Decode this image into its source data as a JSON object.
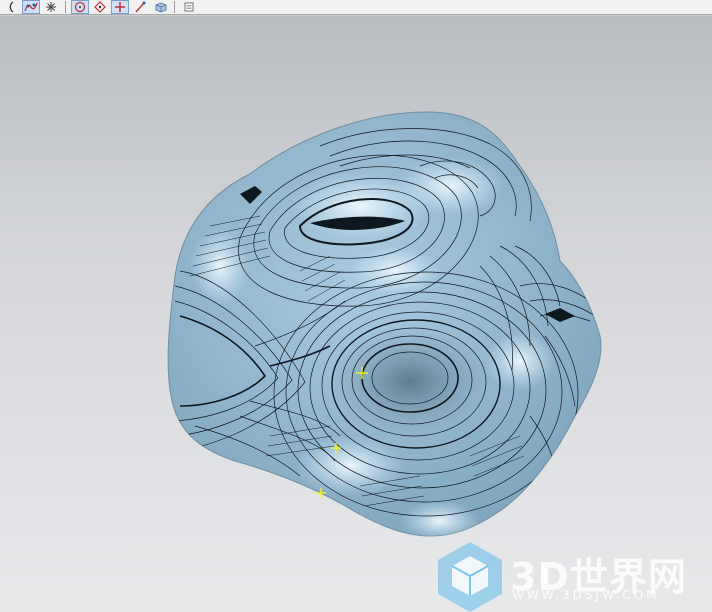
{
  "toolbar": {
    "icons": [
      {
        "name": "arc-tool-icon",
        "glyph": "("
      },
      {
        "name": "spline-tool-icon",
        "glyph": "✎",
        "active": true
      },
      {
        "name": "asterisk-tool-icon",
        "glyph": "✱"
      },
      {
        "name": "circle-tool-icon",
        "glyph": "⊙",
        "active": true
      },
      {
        "name": "point-set-icon",
        "glyph": "◎"
      },
      {
        "name": "crosshair-tool-icon",
        "glyph": "✛",
        "active": true
      },
      {
        "name": "line-pick-icon",
        "glyph": "⟋"
      },
      {
        "name": "view-cube-icon",
        "glyph": "◧"
      },
      {
        "name": "layer-icon",
        "glyph": "▤"
      }
    ]
  },
  "colors": {
    "surface": "#8fb4cc",
    "surface_highlight": "#d8eef9",
    "contour": "#101820",
    "point_marker": "#ffff00",
    "viewport_top": "#b9bcc1",
    "viewport_bottom": "#e8e9eb"
  },
  "watermark": {
    "brand": "3D世界网",
    "url": "WWW.3DSJW.COM"
  }
}
